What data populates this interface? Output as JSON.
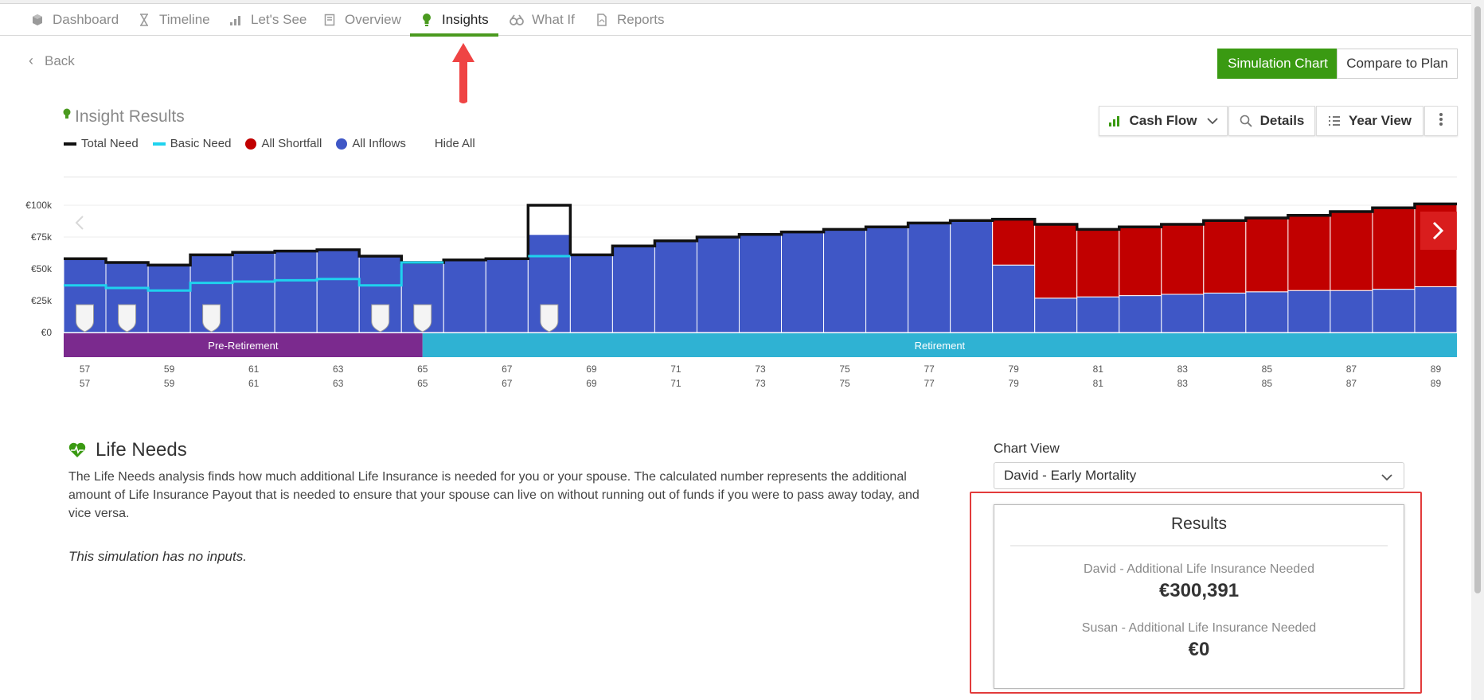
{
  "tabs": [
    {
      "label": "Dashboard",
      "icon": "cube-icon",
      "active": false
    },
    {
      "label": "Timeline",
      "icon": "hourglass-icon",
      "active": false
    },
    {
      "label": "Let's See",
      "icon": "bar-chart-icon",
      "active": false
    },
    {
      "label": "Overview",
      "icon": "document-icon",
      "active": false
    },
    {
      "label": "Insights",
      "icon": "lightbulb-icon",
      "active": true
    },
    {
      "label": "What If",
      "icon": "binoculars-icon",
      "active": false
    },
    {
      "label": "Reports",
      "icon": "pdf-icon",
      "active": false
    }
  ],
  "back_label": "Back",
  "header_buttons": {
    "simulation_chart": "Simulation Chart",
    "compare_to_plan": "Compare to Plan"
  },
  "insight": {
    "title": "Insight Results",
    "legend": {
      "total_need": "Total Need",
      "basic_need": "Basic Need",
      "all_shortfall": "All Shortfall",
      "all_inflows": "All Inflows",
      "hide_all": "Hide All"
    },
    "toolbar": {
      "cash_flow": "Cash Flow",
      "details": "Details",
      "year_view": "Year View"
    }
  },
  "colors": {
    "accent_green": "#3a9a12",
    "inflows": "#3f57c6",
    "shortfall": "#c10000",
    "total_need": "#111111",
    "basic_need": "#1fd2ee",
    "pre_retirement": "#7b2a8e",
    "retirement": "#2fb2d3",
    "highlight_red": "#e23b3b"
  },
  "chart_data": {
    "type": "bar",
    "ylim": [
      0,
      100000
    ],
    "yticks": [
      0,
      25000,
      50000,
      75000,
      100000
    ],
    "ytick_labels": [
      "€0",
      "€25k",
      "€50k",
      "€75k",
      "€100k"
    ],
    "x": [
      57,
      58,
      59,
      60,
      61,
      62,
      63,
      64,
      65,
      66,
      67,
      68,
      69,
      70,
      71,
      72,
      73,
      74,
      75,
      76,
      77,
      78,
      79,
      80,
      81,
      82,
      83,
      84,
      85,
      86,
      87,
      88,
      89
    ],
    "series": [
      {
        "name": "All Inflows",
        "values": [
          58000,
          55000,
          53000,
          61000,
          63000,
          64000,
          65000,
          60000,
          55000,
          57000,
          58000,
          77000,
          61000,
          68000,
          72000,
          75000,
          77000,
          79000,
          81000,
          83000,
          86000,
          88000,
          53000,
          27000,
          28000,
          29000,
          30000,
          31000,
          32000,
          33000,
          33000,
          34000,
          36000
        ]
      },
      {
        "name": "All Shortfall",
        "values": [
          0,
          0,
          0,
          0,
          0,
          0,
          0,
          0,
          0,
          0,
          0,
          0,
          0,
          0,
          0,
          0,
          0,
          0,
          0,
          0,
          0,
          0,
          36000,
          58000,
          53000,
          54000,
          55000,
          57000,
          58000,
          59000,
          62000,
          64000,
          65000
        ]
      },
      {
        "name": "Total Need",
        "values": [
          58000,
          55000,
          53000,
          61000,
          63000,
          64000,
          65000,
          60000,
          55000,
          57000,
          58000,
          100000,
          61000,
          68000,
          72000,
          75000,
          77000,
          79000,
          81000,
          83000,
          86000,
          88000,
          89000,
          85000,
          81000,
          83000,
          85000,
          88000,
          90000,
          92000,
          95000,
          98000,
          101000
        ]
      },
      {
        "name": "Basic Need",
        "values": [
          37000,
          35000,
          33000,
          39000,
          40000,
          41000,
          42000,
          37000,
          55000,
          null,
          null,
          60000,
          null,
          null,
          null,
          null,
          null,
          null,
          null,
          null,
          null,
          null,
          null,
          null,
          null,
          null,
          null,
          null,
          null,
          null,
          null,
          null,
          null
        ]
      }
    ],
    "event_marker_ages": [
      57,
      58,
      60,
      64,
      65,
      68
    ],
    "phases": [
      {
        "label": "Pre-Retirement",
        "from": 57,
        "to": 65
      },
      {
        "label": "Retirement",
        "from": 65,
        "to": 89
      }
    ],
    "xtick_labels_row1": [
      "57",
      "59",
      "61",
      "63",
      "65",
      "67",
      "69",
      "71",
      "73",
      "75",
      "77",
      "79",
      "81",
      "83",
      "85",
      "87",
      "89"
    ],
    "xtick_labels_row2": [
      "57",
      "59",
      "61",
      "63",
      "65",
      "67",
      "69",
      "71",
      "73",
      "75",
      "77",
      "79",
      "81",
      "83",
      "85",
      "87",
      "89"
    ]
  },
  "life_needs": {
    "title": "Life Needs",
    "description": "The Life Needs analysis finds how much additional Life Insurance is needed for you or your spouse. The calculated number represents the additional amount of Life Insurance Payout that is needed to ensure that your spouse can live on without running out of funds if you were to pass away today, and vice versa.",
    "no_inputs": "This simulation has no inputs."
  },
  "chart_view": {
    "label": "Chart View",
    "selected": "David - Early Mortality"
  },
  "results": {
    "title": "Results",
    "david_label": "David - Additional Life Insurance Needed",
    "david_value": "€300,391",
    "susan_label": "Susan - Additional Life Insurance Needed",
    "susan_value": "€0"
  }
}
